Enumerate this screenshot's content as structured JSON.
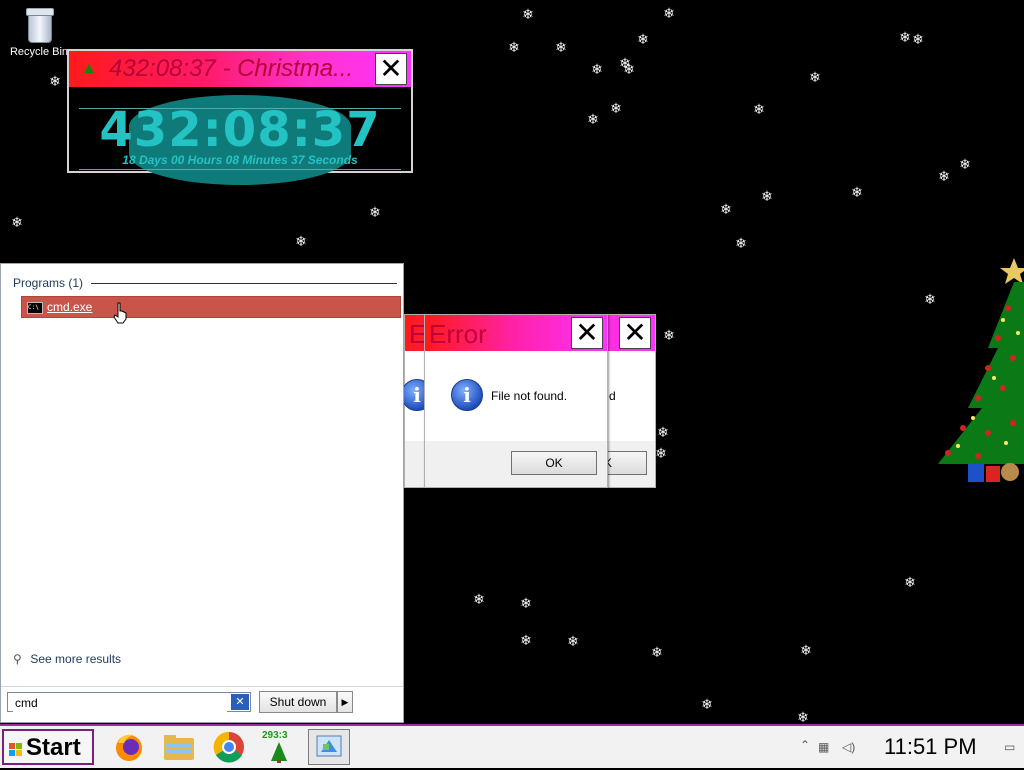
{
  "desktop": {
    "recycle_bin_label": "Recycle Bin"
  },
  "countdown": {
    "title": "432:08:37 - Christma...",
    "time": "432:08:37",
    "detail": "18 Days 00 Hours 08 Minutes 37 Seconds"
  },
  "start_menu": {
    "programs_header": "Programs (1)",
    "result_item": "cmd.exe",
    "see_more": "See more results",
    "search_value": "cmd",
    "shutdown_label": "Shut down"
  },
  "error_dialog_front": {
    "title": "Error",
    "message": "File not found.",
    "ok_label": "OK"
  },
  "error_dialog_back": {
    "title": "Error",
    "message_fragment": "d",
    "ok_fragment": "K"
  },
  "taskbar": {
    "start_label": "Start",
    "tray_counter": "293:3",
    "clock": "11:51 PM"
  },
  "colors": {
    "title_gradient_start": "#ff1a1a",
    "title_gradient_end": "#ff33ff",
    "countdown_text": "#24c3c3",
    "selected_result": "#c9544a",
    "taskbar_border": "#a12aa8"
  },
  "icons": [
    "recycle-bin-icon",
    "christmas-tree-icon",
    "close-icon",
    "info-icon",
    "cmd-icon",
    "magnifier-icon",
    "firefox-icon",
    "file-explorer-icon",
    "chrome-icon",
    "tree-counter-icon",
    "control-panel-icon",
    "windows-logo-icon"
  ]
}
